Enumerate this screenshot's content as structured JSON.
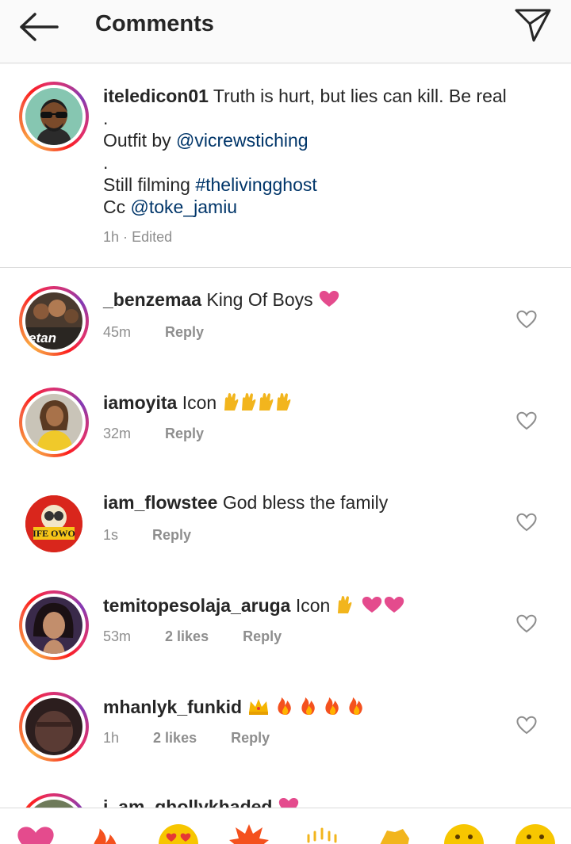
{
  "header": {
    "title": "Comments"
  },
  "caption": {
    "username": "iteledicon01",
    "line1_text": "Truth is hurt, but lies can kill. Be real",
    "dot1": ".",
    "outfit_prefix": "Outfit by",
    "outfit_mention": "@vicrewstiching",
    "dot2": ".",
    "filming_prefix": "Still filming",
    "hashtag": "#thelivingghost",
    "cc_prefix": "Cc",
    "cc_mention": "@toke_jamiu",
    "time": "1h",
    "separator": "·",
    "edited": "Edited"
  },
  "comments": [
    {
      "username": "_benzemaa",
      "text": "King Of Boys",
      "time": "45m",
      "likes": "",
      "reply": "Reply",
      "avatar_label": "etan"
    },
    {
      "username": "iamoyita",
      "text": "Icon",
      "time": "32m",
      "likes": "",
      "reply": "Reply"
    },
    {
      "username": "iam_flowstee",
      "text": "God bless the family",
      "time": "1s",
      "likes": "",
      "reply": "Reply",
      "avatar_label": "IFE OWO"
    },
    {
      "username": "temitopesolaja_aruga",
      "text": "Icon",
      "time": "53m",
      "likes": "2 likes",
      "reply": "Reply"
    },
    {
      "username": "mhanlyk_funkid",
      "text": "",
      "time": "1h",
      "likes": "2 likes",
      "reply": "Reply"
    },
    {
      "username": "i_am_ghollykhaded",
      "text": ""
    }
  ],
  "colors": {
    "link": "#003569",
    "meta": "#8e8e8e",
    "heart": "#e1306c"
  },
  "icons": [
    "back-arrow-icon",
    "send-icon",
    "heart-outline-icon",
    "red-heart-emoji",
    "raising-hands-emoji",
    "crown-emoji",
    "fire-emoji",
    "heart-eyes-emoji",
    "clapping-emoji",
    "smile-emoji"
  ]
}
